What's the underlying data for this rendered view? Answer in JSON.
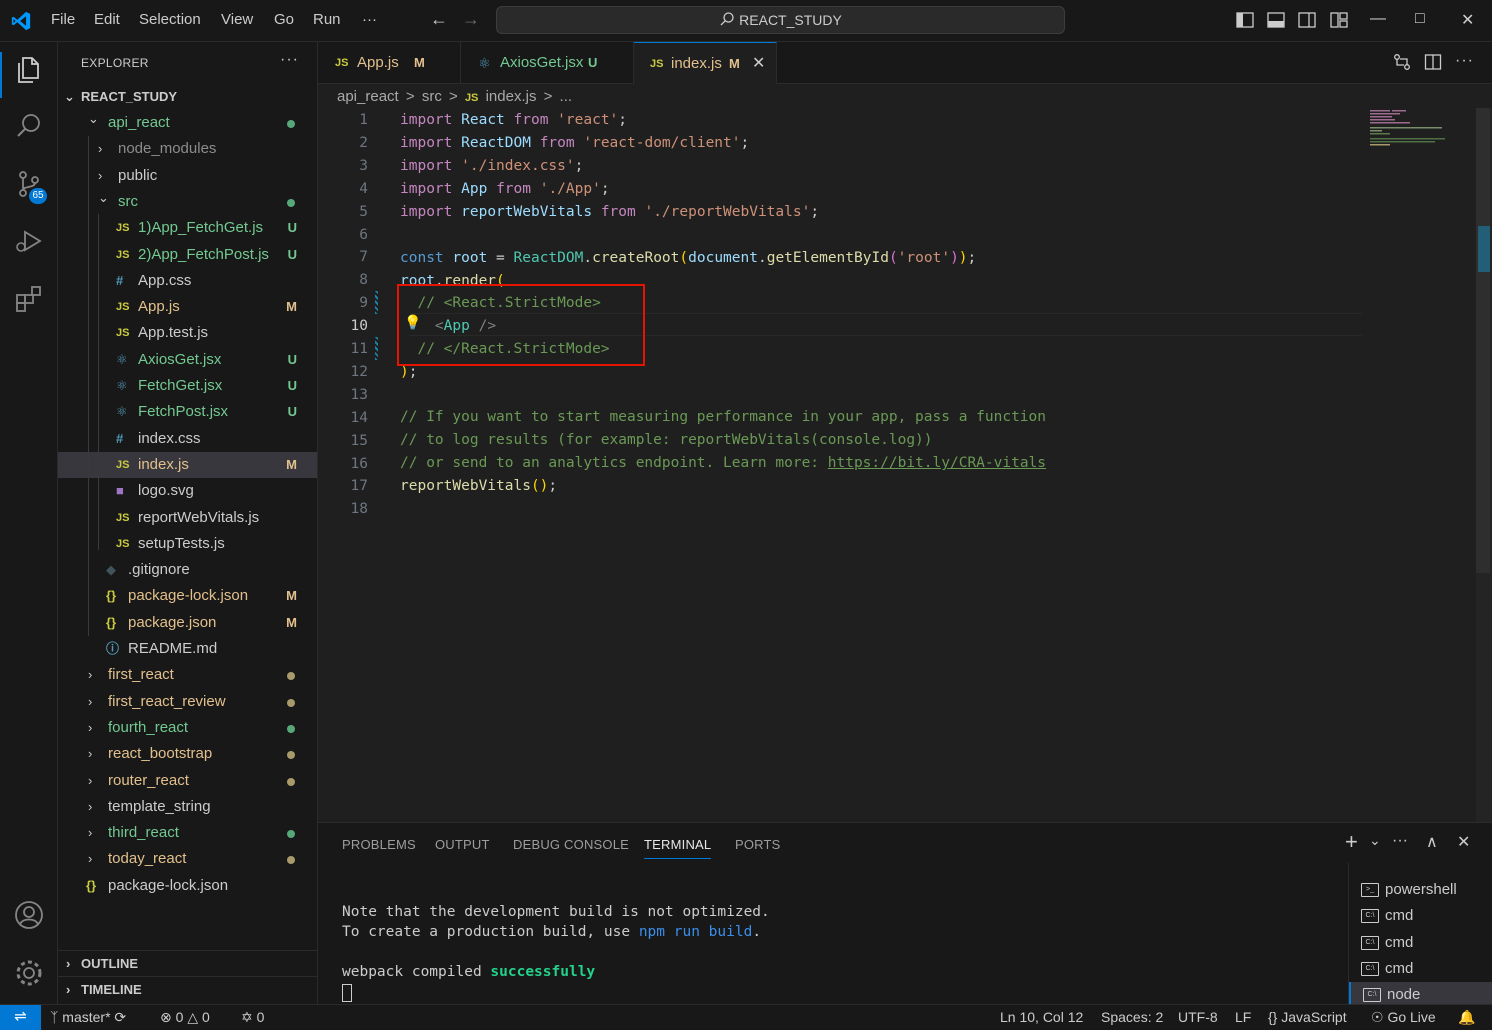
{
  "titlebar": {
    "menus": [
      "File",
      "Edit",
      "Selection",
      "View",
      "Go",
      "Run",
      "···"
    ],
    "search_text": "REACT_STUDY",
    "win_minimize": "—",
    "win_maximize": "□",
    "win_close": "✕",
    "nav_back": "←",
    "nav_forward": "→"
  },
  "activitybar": {
    "icons": [
      "files-icon",
      "search-icon",
      "source-control-icon",
      "run-debug-icon",
      "extensions-icon",
      "account-icon",
      "manage-gear-icon"
    ],
    "scm_badge": "65"
  },
  "sidebar": {
    "title": "EXPLORER",
    "more": "···",
    "root": "REACT_STUDY",
    "tree": [
      {
        "label": "api_react",
        "type": "folder",
        "open": true,
        "status": "dot",
        "color": "#73c991"
      },
      {
        "label": "node_modules",
        "type": "folder",
        "open": false,
        "color": "#8c8c8c"
      },
      {
        "label": "public",
        "type": "folder",
        "open": false,
        "color": "#cccccc"
      },
      {
        "label": "src",
        "type": "folder",
        "open": true,
        "status": "dot",
        "color": "#73c991"
      },
      {
        "label": "1)App_FetchGet.js",
        "icon": "JS",
        "status": "U",
        "color": "#73c991"
      },
      {
        "label": "2)App_FetchPost.js",
        "icon": "JS",
        "status": "U",
        "color": "#73c991"
      },
      {
        "label": "App.css",
        "icon": "#",
        "color": "#cccccc"
      },
      {
        "label": "App.js",
        "icon": "JS",
        "status": "M",
        "color": "#e2c08d"
      },
      {
        "label": "App.test.js",
        "icon": "JS",
        "color": "#cccccc"
      },
      {
        "label": "AxiosGet.jsx",
        "icon": "⚛",
        "status": "U",
        "color": "#73c991"
      },
      {
        "label": "FetchGet.jsx",
        "icon": "⚛",
        "status": "U",
        "color": "#73c991"
      },
      {
        "label": "FetchPost.jsx",
        "icon": "⚛",
        "status": "U",
        "color": "#73c991"
      },
      {
        "label": "index.css",
        "icon": "#",
        "color": "#cccccc"
      },
      {
        "label": "index.js",
        "icon": "JS",
        "status": "M",
        "color": "#e2c08d",
        "selected": true
      },
      {
        "label": "logo.svg",
        "icon": "■",
        "color": "#cccccc"
      },
      {
        "label": "reportWebVitals.js",
        "icon": "JS",
        "color": "#cccccc"
      },
      {
        "label": "setupTests.js",
        "icon": "JS",
        "color": "#cccccc"
      },
      {
        "label": ".gitignore",
        "icon": "◆",
        "color": "#cccccc"
      },
      {
        "label": "package-lock.json",
        "icon": "{}",
        "status": "M",
        "color": "#e2c08d"
      },
      {
        "label": "package.json",
        "icon": "{}",
        "status": "M",
        "color": "#e2c08d"
      },
      {
        "label": "README.md",
        "icon": "ⓘ",
        "color": "#cccccc"
      },
      {
        "label": "first_react",
        "type": "folder",
        "status": "dot",
        "color": "#e2c08d"
      },
      {
        "label": "first_react_review",
        "type": "folder",
        "status": "dot",
        "color": "#e2c08d"
      },
      {
        "label": "fourth_react",
        "type": "folder",
        "status": "dot",
        "color": "#73c991"
      },
      {
        "label": "react_bootstrap",
        "type": "folder",
        "status": "dot",
        "color": "#e2c08d"
      },
      {
        "label": "router_react",
        "type": "folder",
        "status": "dot",
        "color": "#e2c08d"
      },
      {
        "label": "template_string",
        "type": "folder",
        "color": "#cccccc"
      },
      {
        "label": "third_react",
        "type": "folder",
        "status": "dot",
        "color": "#73c991"
      },
      {
        "label": "today_react",
        "type": "folder",
        "status": "dot",
        "color": "#e2c08d"
      },
      {
        "label": "package-lock.json",
        "icon": "{}",
        "color": "#cccccc"
      }
    ],
    "outline": "OUTLINE",
    "timeline": "TIMELINE"
  },
  "tabs": [
    {
      "icon": "JS",
      "label": "App.js",
      "status": "M",
      "color": "#e2c08d"
    },
    {
      "icon": "⚛",
      "label": "AxiosGet.jsx",
      "status": "U",
      "color": "#73c991"
    },
    {
      "icon": "JS",
      "label": "index.js",
      "status": "M",
      "color": "#e2c08d",
      "active": true,
      "close": "✕"
    }
  ],
  "breadcrumb": [
    "api_react",
    ">",
    "src",
    ">",
    "JS",
    "index.js",
    ">",
    "..."
  ],
  "editor": {
    "line_numbers": [
      "1",
      "2",
      "3",
      "4",
      "5",
      "6",
      "7",
      "8",
      "9",
      "10",
      "11",
      "12",
      "13",
      "14",
      "15",
      "16",
      "17",
      "18"
    ],
    "current_line": "10",
    "link": "https://bit.ly/CRA-vitals"
  },
  "panel": {
    "tabs": [
      "PROBLEMS",
      "OUTPUT",
      "DEBUG CONSOLE",
      "TERMINAL",
      "PORTS"
    ],
    "active_tab": "TERMINAL",
    "terminal_lines": {
      "l1": "Note that the development build is not optimized.",
      "l2_prefix": "To create a production build, use ",
      "l2_cmd": "npm run build",
      "l2_suffix": ".",
      "l3_prefix": "webpack compiled ",
      "l3_status": "successfully"
    },
    "terminals": [
      {
        "label": "powershell",
        "icon": ">_"
      },
      {
        "label": "cmd",
        "icon": "C:\\"
      },
      {
        "label": "cmd",
        "icon": "C:\\"
      },
      {
        "label": "cmd",
        "icon": "C:\\"
      },
      {
        "label": "node",
        "icon": "C:\\",
        "selected": true
      }
    ],
    "actions": {
      "add": "+",
      "dropdown": "⌄",
      "more": "···",
      "maximize": "∧",
      "close": "✕"
    }
  },
  "statusbar": {
    "branch": "master*",
    "errors": "0",
    "warnings": "0",
    "ports": "0",
    "position": "Ln 10, Col 12",
    "spaces": "Spaces: 2",
    "encoding": "UTF-8",
    "eol": "LF",
    "language": "JavaScript",
    "golive": "Go Live"
  },
  "colors": {
    "accent": "#0078d4",
    "highlight_box": "#e51400",
    "untracked": "#73c991",
    "modified": "#e2c08d"
  }
}
